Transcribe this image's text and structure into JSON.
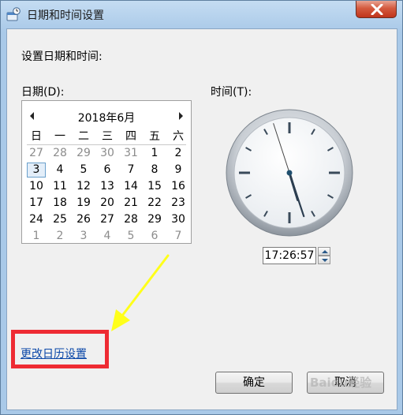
{
  "window": {
    "title": "日期和时间设置",
    "close_icon": "close-icon",
    "app_icon": "date-time-settings-icon"
  },
  "heading": "设置日期和时间:",
  "date_label": "日期(D):",
  "time_label": "时间(T):",
  "calendar": {
    "month_title": "2018年6月",
    "prev_icon": "chevron-left-icon",
    "next_icon": "chevron-right-icon",
    "weekdays": [
      "日",
      "一",
      "二",
      "三",
      "四",
      "五",
      "六"
    ],
    "selected_day": "3",
    "weeks": [
      [
        {
          "d": "27",
          "o": true
        },
        {
          "d": "28",
          "o": true
        },
        {
          "d": "29",
          "o": true
        },
        {
          "d": "30",
          "o": true
        },
        {
          "d": "31",
          "o": true
        },
        {
          "d": "1",
          "o": false
        },
        {
          "d": "2",
          "o": false
        }
      ],
      [
        {
          "d": "3",
          "o": false
        },
        {
          "d": "4",
          "o": false
        },
        {
          "d": "5",
          "o": false
        },
        {
          "d": "6",
          "o": false
        },
        {
          "d": "7",
          "o": false
        },
        {
          "d": "8",
          "o": false
        },
        {
          "d": "9",
          "o": false
        }
      ],
      [
        {
          "d": "10",
          "o": false
        },
        {
          "d": "11",
          "o": false
        },
        {
          "d": "12",
          "o": false
        },
        {
          "d": "13",
          "o": false
        },
        {
          "d": "14",
          "o": false
        },
        {
          "d": "15",
          "o": false
        },
        {
          "d": "16",
          "o": false
        }
      ],
      [
        {
          "d": "17",
          "o": false
        },
        {
          "d": "18",
          "o": false
        },
        {
          "d": "19",
          "o": false
        },
        {
          "d": "20",
          "o": false
        },
        {
          "d": "21",
          "o": false
        },
        {
          "d": "22",
          "o": false
        },
        {
          "d": "23",
          "o": false
        }
      ],
      [
        {
          "d": "24",
          "o": false
        },
        {
          "d": "25",
          "o": false
        },
        {
          "d": "26",
          "o": false
        },
        {
          "d": "27",
          "o": false
        },
        {
          "d": "28",
          "o": false
        },
        {
          "d": "29",
          "o": false
        },
        {
          "d": "30",
          "o": false
        }
      ],
      [
        {
          "d": "1",
          "o": true
        },
        {
          "d": "2",
          "o": true
        },
        {
          "d": "3",
          "o": true
        },
        {
          "d": "4",
          "o": true
        },
        {
          "d": "5",
          "o": true
        },
        {
          "d": "6",
          "o": true
        },
        {
          "d": "7",
          "o": true
        }
      ]
    ]
  },
  "clock": {
    "time": "17:26:57",
    "hour": 17,
    "minute": 26,
    "second": 57
  },
  "change_calendar_link": "更改日历设置",
  "buttons": {
    "ok": "确定",
    "cancel": "取消"
  },
  "annotation": {
    "box_color": "#ee2b33",
    "arrow_color": "#ffff1a"
  },
  "watermark": "Baidu经验"
}
